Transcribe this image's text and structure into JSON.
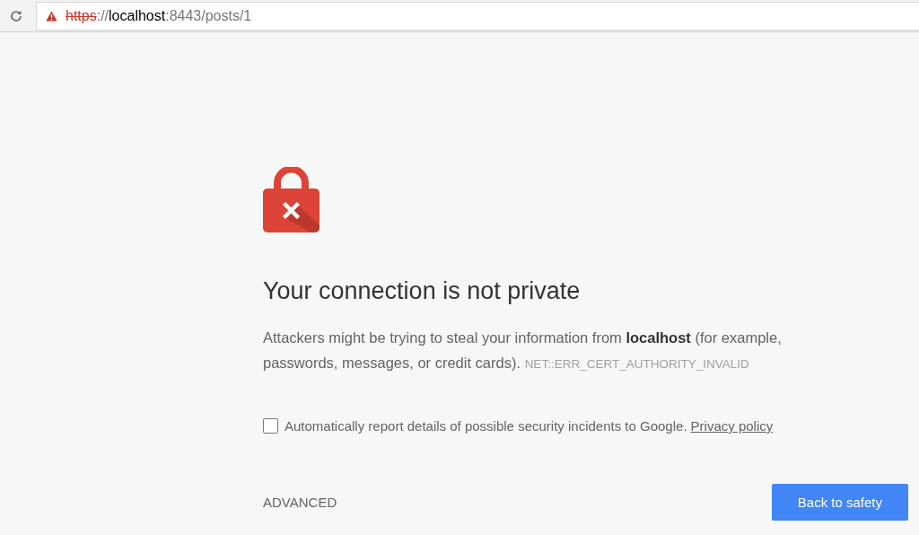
{
  "address_bar": {
    "security_warning": true,
    "scheme": "https",
    "separator": "://",
    "host": "localhost",
    "rest": ":8443/posts/1"
  },
  "heading": "Your connection is not private",
  "message": "Attackers might be trying to steal your information from **localhost** (for example, passwords, messages, or credit cards).",
  "error_code": "NET::ERR_CERT_AUTHORITY_INVALID",
  "report_checkbox": {
    "label": "Automatically report details of possible security incidents to Google.",
    "checked": false,
    "link": "Privacy policy"
  },
  "advanced_button": "ADVANCED",
  "primary_button": "Back to safety"
}
